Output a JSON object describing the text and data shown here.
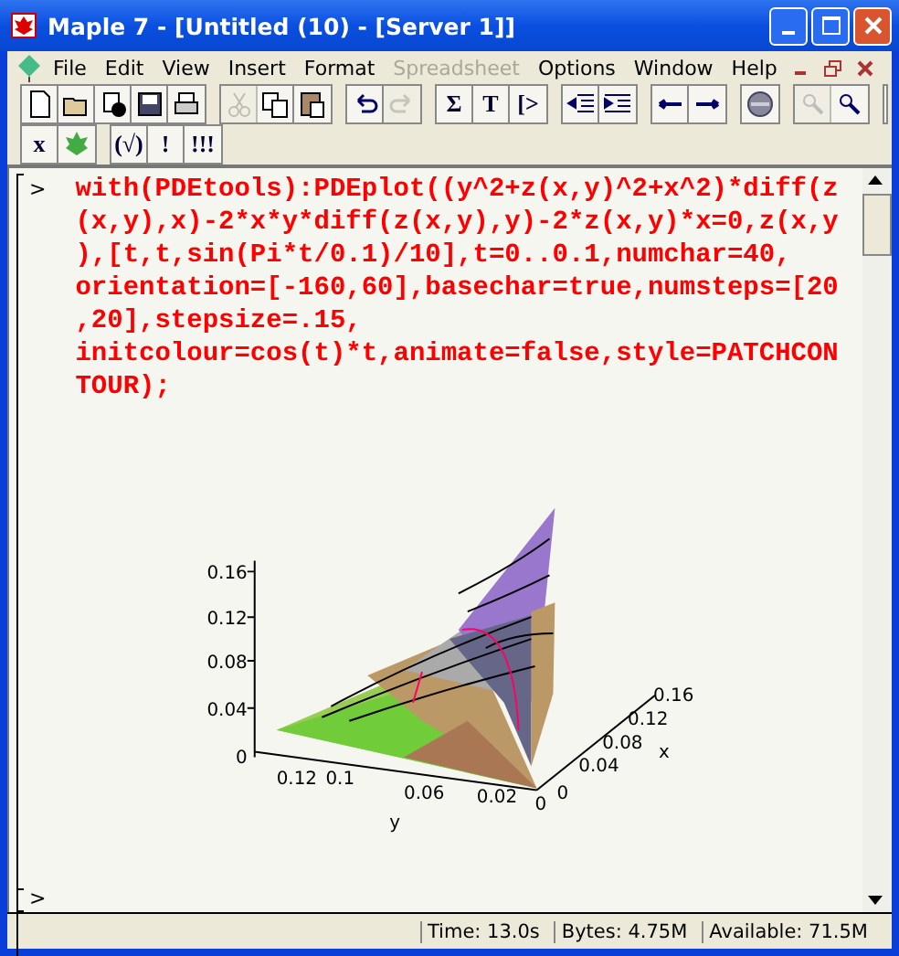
{
  "window": {
    "title": "Maple 7  - [Untitled (10) - [Server 1]]"
  },
  "menu": [
    {
      "label": "File",
      "disabled": false
    },
    {
      "label": "Edit",
      "disabled": false
    },
    {
      "label": "View",
      "disabled": false
    },
    {
      "label": "Insert",
      "disabled": false
    },
    {
      "label": "Format",
      "disabled": false
    },
    {
      "label": "Spreadsheet",
      "disabled": true
    },
    {
      "label": "Options",
      "disabled": false
    },
    {
      "label": "Window",
      "disabled": false
    },
    {
      "label": "Help",
      "disabled": false
    }
  ],
  "toolbar": [
    [
      {
        "kind": "new",
        "disabled": false
      },
      {
        "kind": "open",
        "disabled": false
      },
      {
        "kind": "server",
        "disabled": false
      },
      {
        "kind": "save",
        "disabled": false
      },
      {
        "kind": "print",
        "disabled": false
      }
    ],
    [
      {
        "kind": "cut",
        "disabled": true
      },
      {
        "kind": "copy",
        "disabled": false
      },
      {
        "kind": "paste",
        "disabled": false
      }
    ],
    [
      {
        "kind": "undo",
        "disabled": false
      },
      {
        "kind": "redo",
        "disabled": true
      }
    ],
    [
      {
        "kind": "text",
        "label": "Σ",
        "disabled": false
      },
      {
        "kind": "text",
        "label": "T",
        "disabled": false
      },
      {
        "kind": "text",
        "label": "[>",
        "disabled": false
      }
    ],
    [
      {
        "kind": "outdent",
        "disabled": false
      },
      {
        "kind": "indent",
        "disabled": false
      }
    ],
    [
      {
        "kind": "back",
        "disabled": false
      },
      {
        "kind": "forward",
        "disabled": false
      }
    ],
    [
      {
        "kind": "stop",
        "disabled": false
      }
    ],
    [
      {
        "kind": "zoomout",
        "disabled": true
      },
      {
        "kind": "zoomin",
        "disabled": false
      }
    ]
  ],
  "toolbar2": [
    [
      {
        "kind": "text",
        "label": "x",
        "disabled": false
      },
      {
        "kind": "leaf",
        "disabled": false
      }
    ],
    [
      {
        "kind": "text",
        "label": "(√)",
        "disabled": false
      },
      {
        "kind": "text",
        "label": "!",
        "disabled": false
      },
      {
        "kind": "text",
        "label": "!!!",
        "disabled": false
      }
    ]
  ],
  "worksheet": {
    "prompt": ">",
    "input_lines": [
      "with(PDEtools):PDEplot((y^2+z(x,y)^2+x^2)*diff(z",
      "(x,y),x)-2*x*y*diff(z(x,y),y)-2*z(x,y)*x=0,z(x,y",
      "),[t,t,sin(Pi*t/0.1)/10],t=0..0.1,numchar=40,",
      "orientation=[-160,60],basechar=true,numsteps=[20",
      ",20],stepsize=.15,",
      "initcolour=cos(t)*t,animate=false,style=PATCHCON",
      "TOUR);"
    ],
    "plot": {
      "z_ticks": [
        "0.16",
        "0.12",
        "0.08",
        "0.04",
        "0"
      ],
      "y_ticks": [
        "0.12",
        "0.1",
        "0.06",
        "0.02",
        "0"
      ],
      "y_label": "y",
      "x_ticks": [
        "0",
        "0.04",
        "0.08",
        "0.12",
        "0.16"
      ],
      "x_label": "x"
    },
    "next_prompt": ">"
  },
  "status_bar": [
    "Time: 13.0s",
    "Bytes: 4.75M",
    "Available: 71.5M"
  ]
}
